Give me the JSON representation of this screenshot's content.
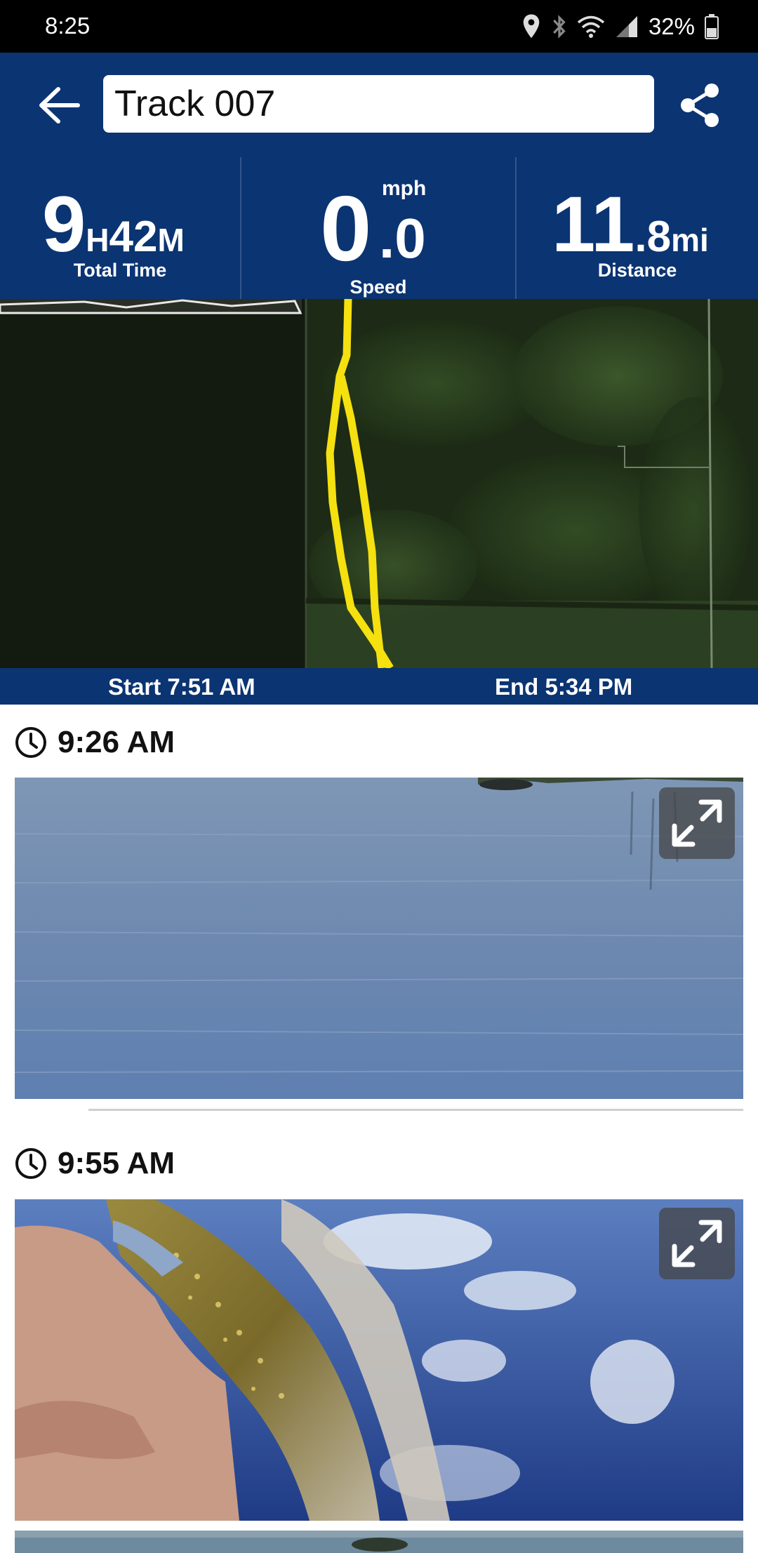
{
  "status_bar": {
    "time": "8:25",
    "battery_percent": "32%",
    "icons": [
      "location-icon",
      "bluetooth-icon",
      "wifi-icon",
      "signal-icon",
      "battery-icon"
    ]
  },
  "header": {
    "title_value": "Track 007",
    "back_icon": "arrow-left-icon",
    "share_icon": "share-icon"
  },
  "stats": {
    "total_time": {
      "hours": "9",
      "hours_unit": "H",
      "minutes": "42",
      "minutes_unit": "M",
      "label": "Total Time"
    },
    "speed": {
      "whole": "0",
      "decimal": ".0",
      "unit": "mph",
      "label": "Speed"
    },
    "distance": {
      "whole": "11",
      "decimal": ".8",
      "unit": "mi",
      "label": "Distance"
    }
  },
  "track": {
    "start": "Start 7:51 AM",
    "end": "End 5:34 PM",
    "colors": {
      "track_line": "#f5e010",
      "header_bg": "#0b3472"
    }
  },
  "entries": [
    {
      "time": "9:26 AM",
      "photo": "lake water photo"
    },
    {
      "time": "9:55 AM",
      "photo": "caught fish photo"
    }
  ]
}
